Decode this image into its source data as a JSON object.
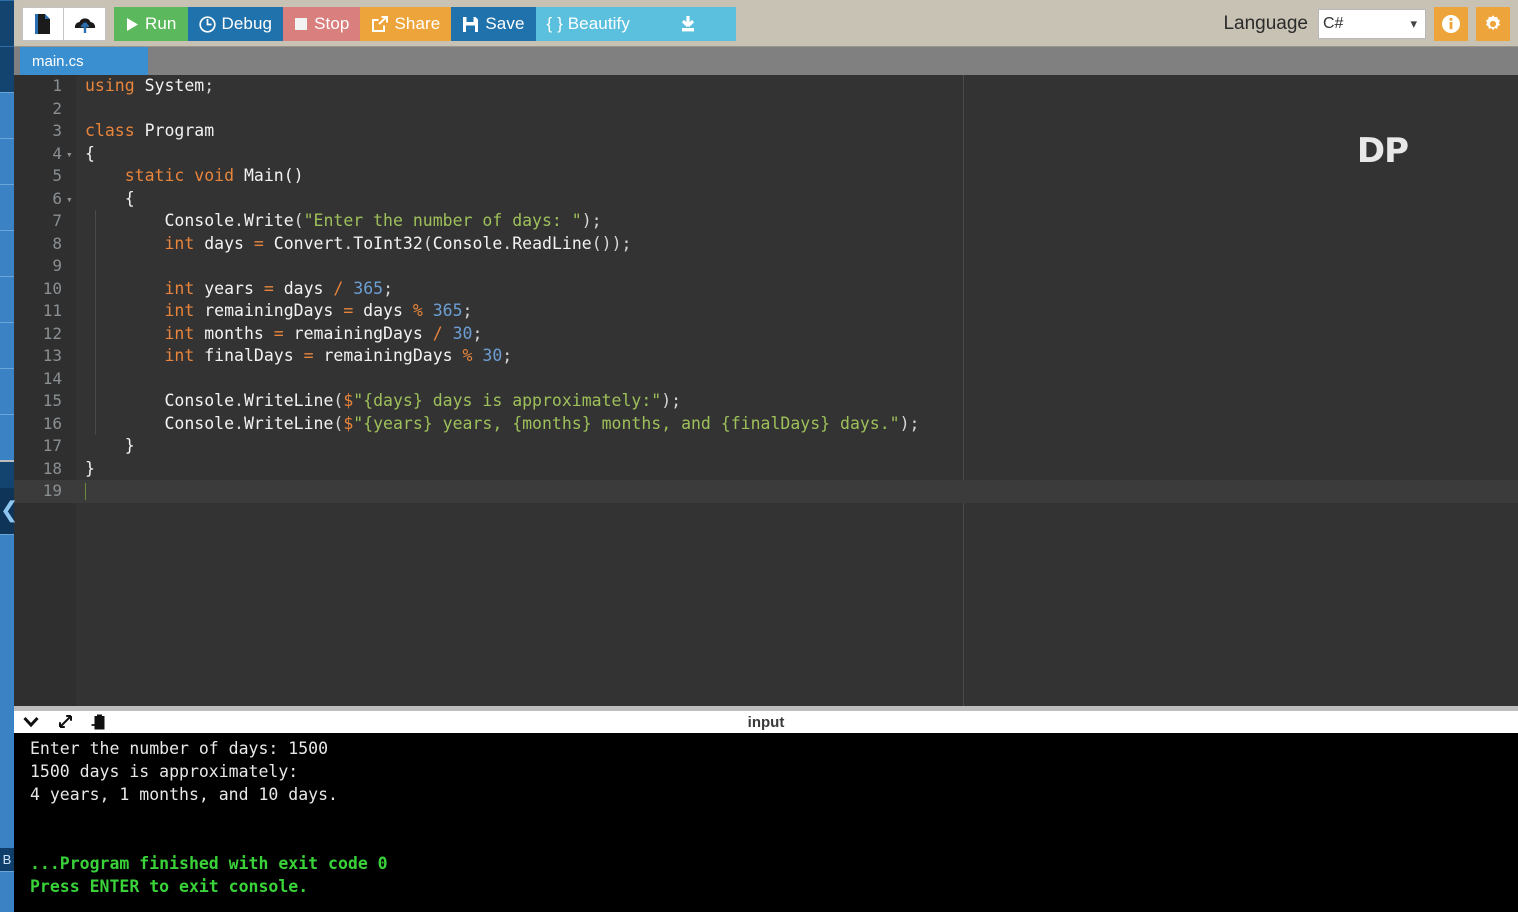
{
  "app": {
    "name": "online-compiler-ide"
  },
  "toolbar": {
    "new_file_icon": "file-icon",
    "upload_icon": "upload-icon",
    "run_label": "Run",
    "debug_label": "Debug",
    "stop_label": "Stop",
    "share_label": "Share",
    "save_label": "Save",
    "beautify_label": "{ } Beautify",
    "download_icon": "download-icon",
    "language_label": "Language",
    "language_value": "C#",
    "info_icon": "info-icon",
    "settings_icon": "gear-icon",
    "colors": {
      "run": "#5cb85c",
      "debug": "#1f72ac",
      "stop": "#d9807f",
      "share": "#eda43a",
      "save": "#1f72ac",
      "beautify": "#5bc0de",
      "download": "#5bc0de",
      "accent_orange": "#eda43a",
      "toolbar_bg": "#c8c2b4"
    }
  },
  "tabs": [
    {
      "label": "main.cs",
      "active": true
    }
  ],
  "editor": {
    "watermark": "DP",
    "language": "C#",
    "active_line": 19,
    "lines": [
      {
        "n": "1",
        "fold": false,
        "indent": 0,
        "tokens": [
          {
            "t": "using",
            "c": "kw"
          },
          {
            "t": " ",
            "c": "pl"
          },
          {
            "t": "System",
            "c": "id"
          },
          {
            "t": ";",
            "c": "pl"
          }
        ]
      },
      {
        "n": "2",
        "fold": false,
        "indent": 0,
        "tokens": []
      },
      {
        "n": "3",
        "fold": false,
        "indent": 0,
        "tokens": [
          {
            "t": "class",
            "c": "kw"
          },
          {
            "t": " ",
            "c": "pl"
          },
          {
            "t": "Program",
            "c": "id"
          }
        ]
      },
      {
        "n": "4",
        "fold": true,
        "indent": 0,
        "tokens": [
          {
            "t": "{",
            "c": "id"
          }
        ]
      },
      {
        "n": "5",
        "fold": false,
        "indent": 0,
        "tokens": [
          {
            "t": "    ",
            "c": "pl"
          },
          {
            "t": "static",
            "c": "kw"
          },
          {
            "t": " ",
            "c": "pl"
          },
          {
            "t": "void",
            "c": "kw"
          },
          {
            "t": " ",
            "c": "pl"
          },
          {
            "t": "Main",
            "c": "id"
          },
          {
            "t": "()",
            "c": "id"
          }
        ]
      },
      {
        "n": "6",
        "fold": true,
        "indent": 0,
        "tokens": [
          {
            "t": "    ",
            "c": "pl"
          },
          {
            "t": "{",
            "c": "id"
          }
        ]
      },
      {
        "n": "7",
        "fold": false,
        "indent": 1,
        "tokens": [
          {
            "t": "        ",
            "c": "pl"
          },
          {
            "t": "Console",
            "c": "id"
          },
          {
            "t": ".",
            "c": "pl"
          },
          {
            "t": "Write",
            "c": "id"
          },
          {
            "t": "(",
            "c": "pl"
          },
          {
            "t": "\"Enter the number of days: \"",
            "c": "str"
          },
          {
            "t": ");",
            "c": "pl"
          }
        ]
      },
      {
        "n": "8",
        "fold": false,
        "indent": 1,
        "tokens": [
          {
            "t": "        ",
            "c": "pl"
          },
          {
            "t": "int",
            "c": "kw"
          },
          {
            "t": " days ",
            "c": "id"
          },
          {
            "t": "=",
            "c": "op"
          },
          {
            "t": " ",
            "c": "pl"
          },
          {
            "t": "Convert",
            "c": "id"
          },
          {
            "t": ".",
            "c": "pl"
          },
          {
            "t": "ToInt32",
            "c": "id"
          },
          {
            "t": "(",
            "c": "pl"
          },
          {
            "t": "Console",
            "c": "id"
          },
          {
            "t": ".",
            "c": "pl"
          },
          {
            "t": "ReadLine",
            "c": "id"
          },
          {
            "t": "());",
            "c": "pl"
          }
        ]
      },
      {
        "n": "9",
        "fold": false,
        "indent": 1,
        "tokens": []
      },
      {
        "n": "10",
        "fold": false,
        "indent": 1,
        "tokens": [
          {
            "t": "        ",
            "c": "pl"
          },
          {
            "t": "int",
            "c": "kw"
          },
          {
            "t": " years ",
            "c": "id"
          },
          {
            "t": "=",
            "c": "op"
          },
          {
            "t": " days ",
            "c": "id"
          },
          {
            "t": "/",
            "c": "op"
          },
          {
            "t": " ",
            "c": "pl"
          },
          {
            "t": "365",
            "c": "num"
          },
          {
            "t": ";",
            "c": "pl"
          }
        ]
      },
      {
        "n": "11",
        "fold": false,
        "indent": 1,
        "tokens": [
          {
            "t": "        ",
            "c": "pl"
          },
          {
            "t": "int",
            "c": "kw"
          },
          {
            "t": " remainingDays ",
            "c": "id"
          },
          {
            "t": "=",
            "c": "op"
          },
          {
            "t": " days ",
            "c": "id"
          },
          {
            "t": "%",
            "c": "op"
          },
          {
            "t": " ",
            "c": "pl"
          },
          {
            "t": "365",
            "c": "num"
          },
          {
            "t": ";",
            "c": "pl"
          }
        ]
      },
      {
        "n": "12",
        "fold": false,
        "indent": 1,
        "tokens": [
          {
            "t": "        ",
            "c": "pl"
          },
          {
            "t": "int",
            "c": "kw"
          },
          {
            "t": " months ",
            "c": "id"
          },
          {
            "t": "=",
            "c": "op"
          },
          {
            "t": " remainingDays ",
            "c": "id"
          },
          {
            "t": "/",
            "c": "op"
          },
          {
            "t": " ",
            "c": "pl"
          },
          {
            "t": "30",
            "c": "num"
          },
          {
            "t": ";",
            "c": "pl"
          }
        ]
      },
      {
        "n": "13",
        "fold": false,
        "indent": 1,
        "tokens": [
          {
            "t": "        ",
            "c": "pl"
          },
          {
            "t": "int",
            "c": "kw"
          },
          {
            "t": " finalDays ",
            "c": "id"
          },
          {
            "t": "=",
            "c": "op"
          },
          {
            "t": " remainingDays ",
            "c": "id"
          },
          {
            "t": "%",
            "c": "op"
          },
          {
            "t": " ",
            "c": "pl"
          },
          {
            "t": "30",
            "c": "num"
          },
          {
            "t": ";",
            "c": "pl"
          }
        ]
      },
      {
        "n": "14",
        "fold": false,
        "indent": 1,
        "tokens": []
      },
      {
        "n": "15",
        "fold": false,
        "indent": 1,
        "tokens": [
          {
            "t": "        ",
            "c": "pl"
          },
          {
            "t": "Console",
            "c": "id"
          },
          {
            "t": ".",
            "c": "pl"
          },
          {
            "t": "WriteLine",
            "c": "id"
          },
          {
            "t": "(",
            "c": "pl"
          },
          {
            "t": "$",
            "c": "op"
          },
          {
            "t": "\"{days} days is approximately:\"",
            "c": "str"
          },
          {
            "t": ");",
            "c": "pl"
          }
        ]
      },
      {
        "n": "16",
        "fold": false,
        "indent": 1,
        "tokens": [
          {
            "t": "        ",
            "c": "pl"
          },
          {
            "t": "Console",
            "c": "id"
          },
          {
            "t": ".",
            "c": "pl"
          },
          {
            "t": "WriteLine",
            "c": "id"
          },
          {
            "t": "(",
            "c": "pl"
          },
          {
            "t": "$",
            "c": "op"
          },
          {
            "t": "\"{years} years, {months} months, and {finalDays} days.\"",
            "c": "str"
          },
          {
            "t": ");",
            "c": "pl"
          }
        ]
      },
      {
        "n": "17",
        "fold": false,
        "indent": 0,
        "tokens": [
          {
            "t": "    ",
            "c": "pl"
          },
          {
            "t": "}",
            "c": "id"
          }
        ]
      },
      {
        "n": "18",
        "fold": false,
        "indent": 0,
        "tokens": [
          {
            "t": "}",
            "c": "id"
          }
        ]
      },
      {
        "n": "19",
        "fold": false,
        "indent": 0,
        "tokens": []
      }
    ]
  },
  "console_panel": {
    "title": "input",
    "icons": {
      "collapse": "chevron-down-icon",
      "expand": "expand-arrows-icon",
      "paste": "clipboard-paste-icon"
    },
    "output": [
      {
        "text": "Enter the number of days: 1500",
        "style": "normal"
      },
      {
        "text": "1500 days is approximately:",
        "style": "normal"
      },
      {
        "text": "4 years, 1 months, and 10 days.",
        "style": "normal"
      },
      {
        "text": "",
        "style": "spacer"
      },
      {
        "text": "...Program finished with exit code 0",
        "style": "green"
      },
      {
        "text": "Press ENTER to exit console.",
        "style": "green"
      }
    ]
  },
  "left_strip": {
    "collapse_icon": "chevron-left-icon",
    "badge_label": "B"
  }
}
